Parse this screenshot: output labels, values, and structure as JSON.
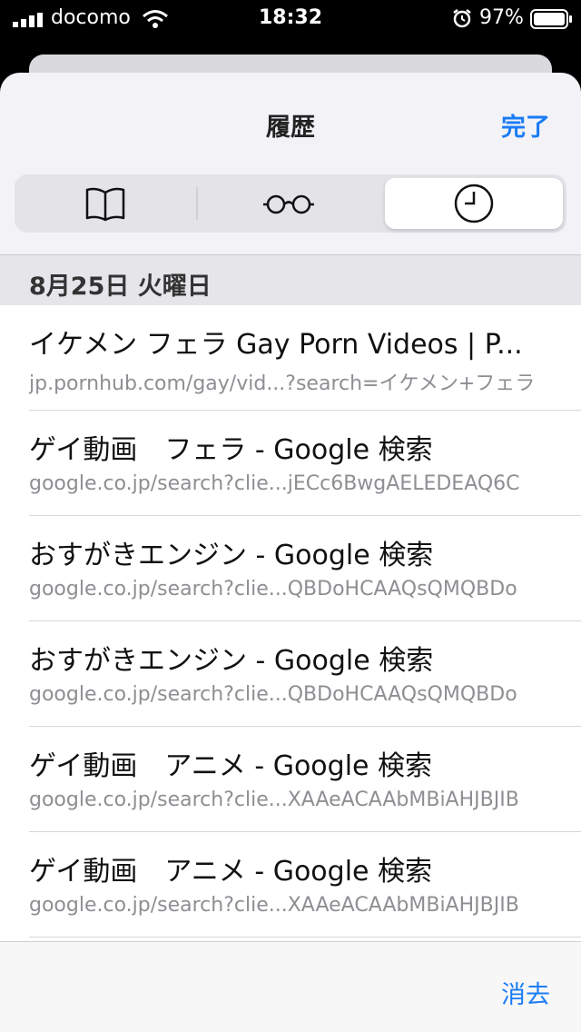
{
  "status_bar": {
    "carrier": "docomo",
    "time": "18:32",
    "battery": "97%"
  },
  "sheet": {
    "title": "履歴",
    "done_label": "完了",
    "clear_label": "消去"
  },
  "tabs": [
    {
      "icon": "book-icon",
      "name": "bookmarks"
    },
    {
      "icon": "glasses-icon",
      "name": "reading-list"
    },
    {
      "icon": "clock-icon",
      "name": "history",
      "active": true
    }
  ],
  "section": {
    "date_header": "8月25日 火曜日"
  },
  "history": [
    {
      "title": "イケメン フェラ Gay Porn Videos | P...",
      "url": "jp.pornhub.com/gay/vid...?search=イケメン+フェラ"
    },
    {
      "title": "ゲイ動画　フェラ - Google 検索",
      "url": "google.co.jp/search?clie...jECc6BwgAELEDEAQ6C"
    },
    {
      "title": "おすがきエンジン - Google 検索",
      "url": "google.co.jp/search?clie...QBDoHCAAQsQMQBDo"
    },
    {
      "title": "おすがきエンジン - Google 検索",
      "url": "google.co.jp/search?clie...QBDoHCAAQsQMQBDo"
    },
    {
      "title": "ゲイ動画　アニメ - Google 検索",
      "url": "google.co.jp/search?clie...XAAeACAAbMBiAHJBJIB"
    },
    {
      "title": "ゲイ動画　アニメ - Google 検索",
      "url": "google.co.jp/search?clie...XAAeACAAbMBiAHJBJIB"
    }
  ],
  "colors": {
    "accent": "#1a7cf5",
    "background": "#f2f2f7",
    "secondary_text": "#8e8e93"
  }
}
